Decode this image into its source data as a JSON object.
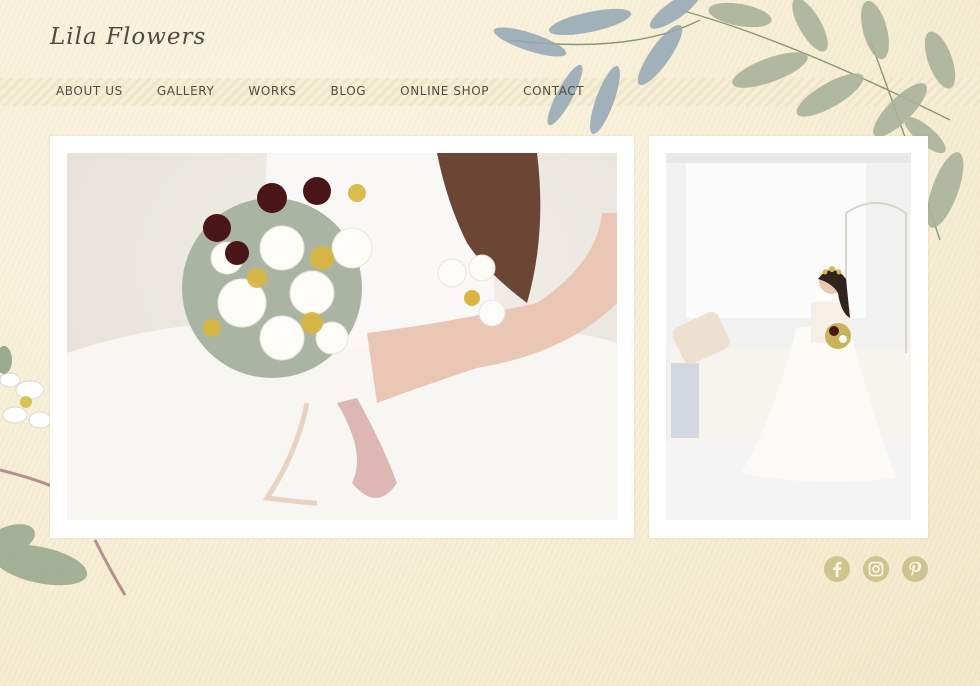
{
  "site": {
    "logo_text": "Lila Flowers"
  },
  "nav": {
    "items": [
      {
        "label": "ABOUT US"
      },
      {
        "label": "GALLERY"
      },
      {
        "label": "WORKS"
      },
      {
        "label": "BLOG"
      },
      {
        "label": "ONLINE SHOP"
      },
      {
        "label": "CONTACT"
      }
    ]
  },
  "gallery": {
    "main_photo_subject": "bridal-bouquet",
    "side_photo_subject": "bride-seated-on-daybed"
  },
  "social": {
    "icons": [
      "facebook-icon",
      "instagram-icon",
      "pinterest-icon"
    ]
  },
  "colors": {
    "background": "#f7efd6",
    "nav_text": "#524c42",
    "logo_text": "#4e4a40",
    "social_icon": "#cfc38f",
    "leaf_green": "#a9b49a",
    "leaf_blue": "#8fa3b3"
  }
}
